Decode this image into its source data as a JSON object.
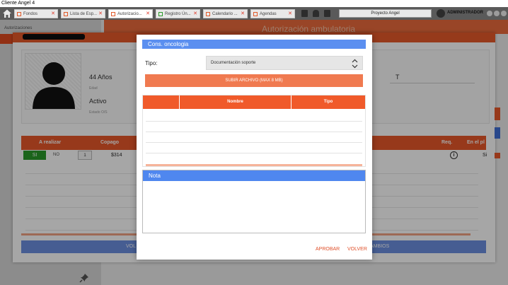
{
  "window": {
    "title": "Cliente Angel 4"
  },
  "topbar": {
    "tabs": [
      {
        "label": "Fondos"
      },
      {
        "label": "Lista de Esp..."
      },
      {
        "label": "Autorizacio..."
      },
      {
        "label": "Registro Ún..."
      },
      {
        "label": "Calendario ..."
      },
      {
        "label": "Agendas"
      }
    ],
    "project": "Proyecto Angel",
    "user": "ADMINISTRADOR"
  },
  "background": {
    "breadcrumb": "Autorizaciones",
    "header_title": "Autorización ambulatoria",
    "patient": {
      "age": "44 Años",
      "age_label": "Edad",
      "status": "Activo",
      "status_label": "Estado O/S"
    },
    "table": {
      "headers": [
        "A realizar",
        "Copago",
        "Req.",
        "En el pl"
      ],
      "row": {
        "si": "SI",
        "no": "NO",
        "qty": "1",
        "copago": "$314",
        "en_plan": "Si"
      }
    },
    "bottom_left": "VOL",
    "bottom_right": "CAMBIOS"
  },
  "modal": {
    "title": "Cons. oncologia",
    "tipo_label": "Tipo:",
    "tipo_value": "Documentación soporte",
    "upload_label": "SUBIR ARCHIVO (MAX 8 MB)",
    "table_headers": {
      "nombre": "Nombre",
      "tipo": "Tipo"
    },
    "nota_title": "Nota",
    "approve": "APROBAR",
    "back": "VOLVER"
  },
  "colors": {
    "accent_orange": "#f05a2a",
    "accent_blue": "#4f87ef",
    "topbar": "#5a5a5a"
  }
}
